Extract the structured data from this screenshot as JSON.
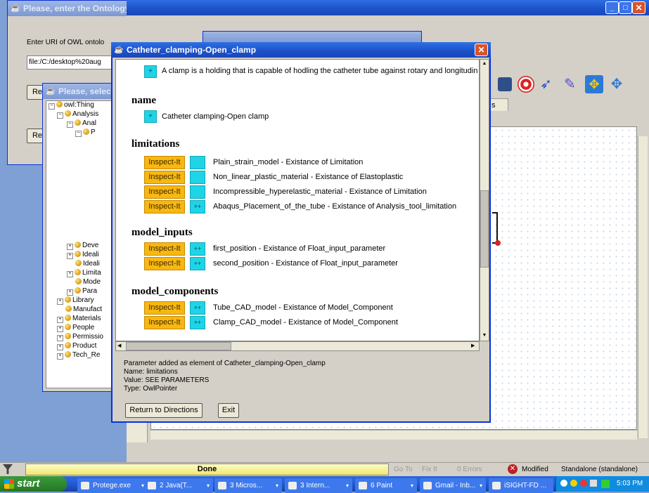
{
  "bg_window": {
    "title": "Please, enter the Ontology URI",
    "prompt_label": "Enter URI of OWL ontolo",
    "uri_value": "file:/C:/desktop%20aug",
    "btn_re1": "Re",
    "btn_re2": "Re"
  },
  "mid_window": {
    "title": "Please, selec",
    "tree": [
      "owl:Thing",
      "Analysis",
      "Anal",
      "P",
      "Deve",
      "Ideali",
      "Ideali",
      "Limita",
      "Mode",
      "Para",
      "Library",
      "Manufact",
      "Materials",
      "People",
      "Permissio",
      "Product",
      "Tech_Re"
    ]
  },
  "right_window": {
    "tab_label": "s",
    "status_done": "Done",
    "go_to": "Go To",
    "fix_it": "Fix It",
    "errors": "0 Errors",
    "modified": "Modified",
    "standalone": "Standalone (standalone)"
  },
  "dialog": {
    "title": "Catheter_clamping-Open_clamp",
    "top_text": "A clamp is a holding that is capable of hodling the catheter tube against rotary and longitudin",
    "sections": {
      "name": {
        "heading": "name",
        "value": "Catheter clamping-Open clamp"
      },
      "limitations": {
        "heading": "limitations",
        "rows": [
          {
            "inspect": "Inspect-It",
            "sq": "",
            "text": "Plain_strain_model - Existance of Limitation"
          },
          {
            "inspect": "Inspect-It",
            "sq": "",
            "text": "Non_linear_plastic_material - Existance of Elastoplastic"
          },
          {
            "inspect": "Inspect-It",
            "sq": "",
            "text": "Incompressible_hyperelastic_material - Existance of Limitation"
          },
          {
            "inspect": "Inspect-It",
            "sq": "++",
            "text": "Abaqus_Placement_of_the_tube - Existance of Analysis_tool_limitation"
          }
        ]
      },
      "model_inputs": {
        "heading": "model_inputs",
        "rows": [
          {
            "inspect": "Inspect-It",
            "sq": "++",
            "text": "first_position - Existance of Float_input_parameter"
          },
          {
            "inspect": "Inspect-It",
            "sq": "++",
            "text": "second_position - Existance of Float_input_parameter"
          }
        ]
      },
      "model_components": {
        "heading": "model_components",
        "rows": [
          {
            "inspect": "Inspect-It",
            "sq": "++",
            "text": "Tube_CAD_model - Existance of Model_Component"
          },
          {
            "inspect": "Inspect-It",
            "sq": "++",
            "text": "Clamp_CAD_model - Existance of Model_Component"
          }
        ]
      }
    },
    "plus": "+",
    "message": {
      "line1": "Parameter added as element of Catheter_clamping-Open_clamp",
      "line2": "Name:   limitations",
      "line3": "Value:  SEE PARAMETERS",
      "line4": "Type:   OwlPointer"
    },
    "return_button": "Return to Directions",
    "exit_button": "Exit"
  },
  "taskbar": {
    "start": "start",
    "items": [
      "Protege.exe",
      "2 Java(T...",
      "3 Micros...",
      "3 Intern...",
      "6 Paint",
      "Gmail - Inb...",
      "iSIGHT-FD ..."
    ],
    "clock": "5:03 PM"
  }
}
